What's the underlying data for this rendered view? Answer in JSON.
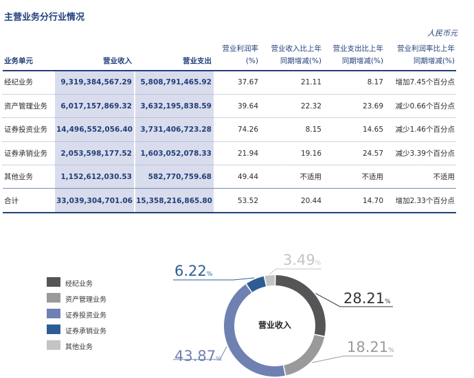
{
  "title": "主营业务分行业情况",
  "unit": "人民币元",
  "headers": {
    "segment": "业务单元",
    "revenue": "营业收入",
    "expense": "营业支出",
    "margin_l1": "营业利润率",
    "margin_l2": "(%)",
    "rev_yoy_l1": "营业收入比上年",
    "rev_yoy_l2": "同期增减(%)",
    "exp_yoy_l1": "营业支出比上年",
    "exp_yoy_l2": "同期增减(%)",
    "margin_yoy_l1": "营业利润率比上年",
    "margin_yoy_l2": "同期增减(%)"
  },
  "rows": [
    {
      "name": "经纪业务",
      "revenue": "9,319,384,567.29",
      "expense": "5,808,791,465.92",
      "margin": "37.67",
      "rev_yoy": "21.11",
      "exp_yoy": "8.17",
      "margin_yoy": "增加7.45个百分点"
    },
    {
      "name": "资产管理业务",
      "revenue": "6,017,157,869.32",
      "expense": "3,632,195,838.59",
      "margin": "39.64",
      "rev_yoy": "22.32",
      "exp_yoy": "23.69",
      "margin_yoy": "减少0.66个百分点"
    },
    {
      "name": "证券投资业务",
      "revenue": "14,496,552,056.40",
      "expense": "3,731,406,723.28",
      "margin": "74.26",
      "rev_yoy": "8.15",
      "exp_yoy": "14.65",
      "margin_yoy": "减少1.46个百分点"
    },
    {
      "name": "证券承销业务",
      "revenue": "2,053,598,177.52",
      "expense": "1,603,052,078.33",
      "margin": "21.94",
      "rev_yoy": "19.16",
      "exp_yoy": "24.57",
      "margin_yoy": "减少3.39个百分点"
    },
    {
      "name": "其他业务",
      "revenue": "1,152,612,030.53",
      "expense": "582,770,759.68",
      "margin": "49.44",
      "rev_yoy": "不适用",
      "exp_yoy": "不适用",
      "margin_yoy": "不适用"
    }
  ],
  "total": {
    "name": "合计",
    "revenue": "33,039,304,701.06",
    "expense": "15,358,216,865.80",
    "margin": "53.52",
    "rev_yoy": "20.44",
    "exp_yoy": "14.70",
    "margin_yoy": "增加2.33个百分点"
  },
  "chart_data": {
    "type": "pie",
    "title": "营业收入",
    "categories": [
      "经纪业务",
      "资产管理业务",
      "证券投资业务",
      "证券承销业务",
      "其他业务"
    ],
    "values": [
      28.21,
      18.21,
      43.87,
      6.22,
      3.49
    ],
    "unit": "%",
    "colors": [
      "#555558",
      "#9a9a9d",
      "#6f80b2",
      "#2e5d95",
      "#c4c4c6"
    ],
    "label_colors": [
      "#333333",
      "#9a9a9d",
      "#6f80b2",
      "#2e5d95",
      "#c4c4c6"
    ],
    "legend_position": "left"
  }
}
